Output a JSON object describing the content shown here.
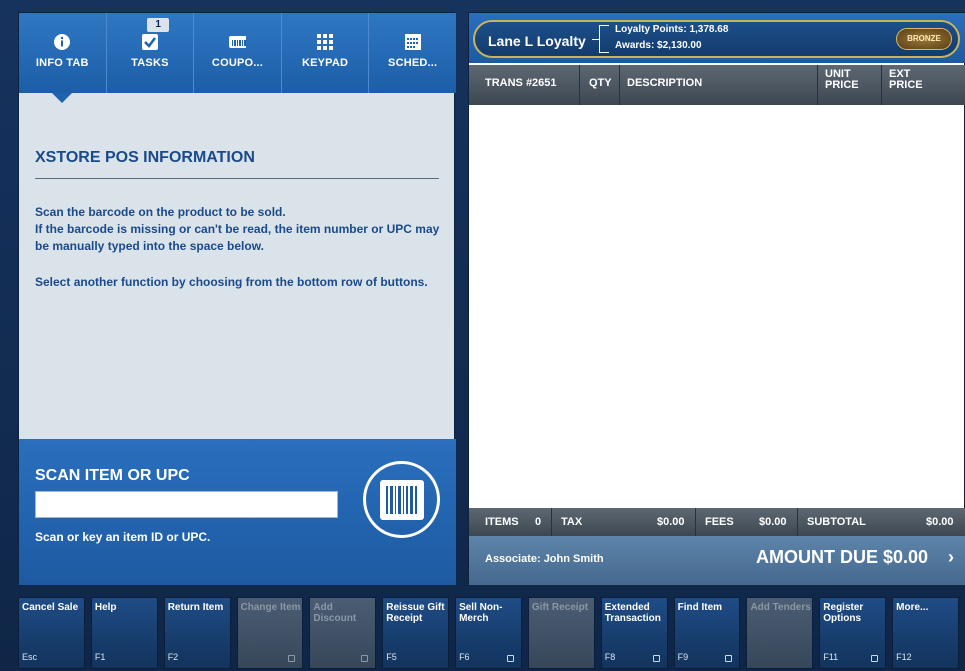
{
  "tabs": [
    {
      "label": "INFO TAB",
      "icon": "info-icon",
      "active": true
    },
    {
      "label": "TASKS",
      "icon": "checkbox-icon",
      "badge": "1"
    },
    {
      "label": "COUPO...",
      "icon": "coupon-icon"
    },
    {
      "label": "KEYPAD",
      "icon": "keypad-icon"
    },
    {
      "label": "SCHED...",
      "icon": "calendar-icon"
    }
  ],
  "info": {
    "title": "XSTORE POS INFORMATION",
    "line1": "Scan the barcode on the product to be sold.",
    "line2": "If the barcode is missing or can't be read, the item number or UPC may be manually typed into the space below.",
    "line3": "Select another function by choosing from the bottom row of buttons."
  },
  "scan": {
    "title": "SCAN ITEM OR UPC",
    "input_value": "",
    "help": "Scan or key an item ID or UPC."
  },
  "loyalty": {
    "name": "Lane L Loyalty",
    "points": "Loyalty Points: 1,378.68",
    "awards": "Awards: $2,130.00",
    "tier": "BRONZE"
  },
  "transaction": {
    "trans_label": "TRANS #2651",
    "col_qty": "QTY",
    "col_desc": "DESCRIPTION",
    "col_unit": "UNIT PRICE",
    "col_ext": "EXT PRICE"
  },
  "totals": {
    "items_label": "ITEMS",
    "items_value": "0",
    "tax_label": "TAX",
    "tax_value": "$0.00",
    "fees_label": "FEES",
    "fees_value": "$0.00",
    "subtotal_label": "SUBTOTAL",
    "subtotal_value": "$0.00"
  },
  "due": {
    "associate": "Associate: John Smith",
    "amount_due": "AMOUNT DUE  $0.00",
    "chevron": "›"
  },
  "function_keys": [
    {
      "label": "Cancel Sale",
      "key": "Esc",
      "enabled": true
    },
    {
      "label": "Help",
      "key": "F1",
      "enabled": true
    },
    {
      "label": "Return Item",
      "key": "F2",
      "enabled": true
    },
    {
      "label": "Change Item",
      "key": "",
      "enabled": false,
      "lock": true
    },
    {
      "label": "Add Discount",
      "key": "",
      "enabled": false,
      "lock": true
    },
    {
      "label": "Reissue Gift Receipt",
      "key": "F5",
      "enabled": true
    },
    {
      "label": "Sell Non-Merch",
      "key": "F6",
      "enabled": true,
      "lock": true
    },
    {
      "label": "Gift Receipt",
      "key": "",
      "enabled": false
    },
    {
      "label": "Extended Transaction",
      "key": "F8",
      "enabled": true,
      "lock": true
    },
    {
      "label": "Find Item",
      "key": "F9",
      "enabled": true,
      "lock": true
    },
    {
      "label": "Add Tenders",
      "key": "",
      "enabled": false
    },
    {
      "label": "Register Options",
      "key": "F11",
      "enabled": true,
      "lock": true
    },
    {
      "label": "More...",
      "key": "F12",
      "enabled": true
    }
  ]
}
